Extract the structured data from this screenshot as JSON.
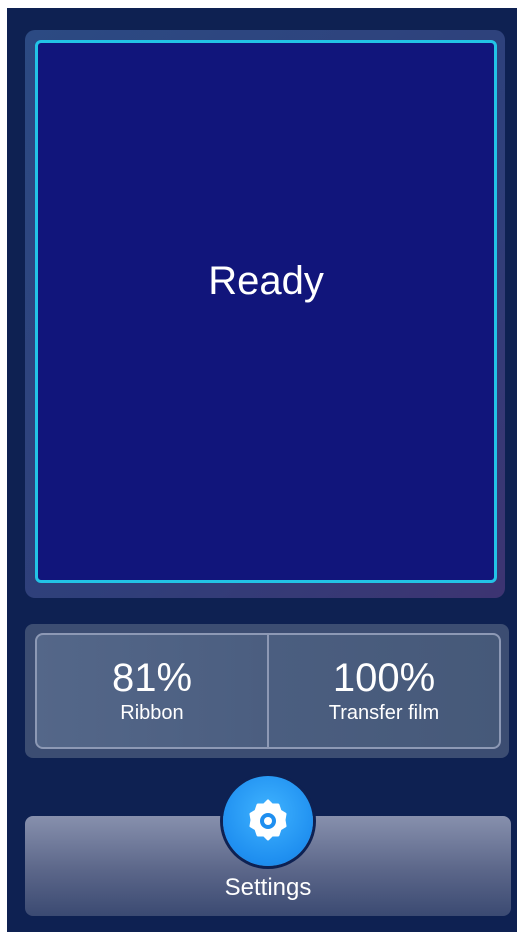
{
  "status": {
    "text": "Ready"
  },
  "supplies": [
    {
      "value": "81%",
      "label": "Ribbon"
    },
    {
      "value": "100%",
      "label": "Transfer film"
    }
  ],
  "settings": {
    "label": "Settings",
    "icon": "gear-icon"
  },
  "colors": {
    "background": "#0e2152",
    "display": "#11157b",
    "display_border": "#22c3e6",
    "accent": "#1f8ff0"
  }
}
